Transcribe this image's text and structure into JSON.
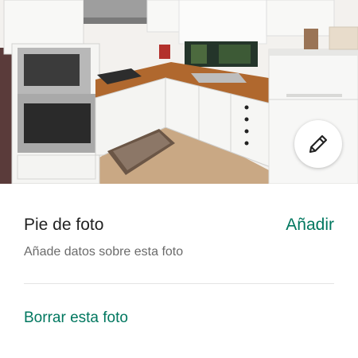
{
  "photo": {
    "subject": "kitchen-photo"
  },
  "edit_button": {
    "icon": "pencil-icon"
  },
  "caption": {
    "title": "Pie de foto",
    "add_label": "Añadir",
    "subtitle": "Añade datos sobre esta foto"
  },
  "actions": {
    "delete_label": "Borrar esta foto"
  },
  "colors": {
    "accent": "#00775f",
    "text_primary": "#222222",
    "text_secondary": "#6b6b6b",
    "divider": "#e4e4e4"
  }
}
